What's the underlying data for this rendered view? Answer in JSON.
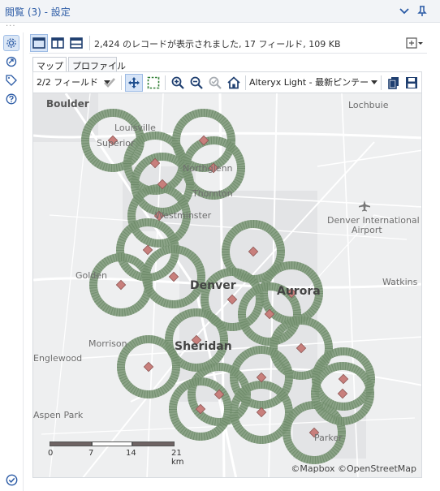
{
  "window": {
    "title": "閲覧 (3) - 設定",
    "icons": [
      "chevron-down-icon",
      "pin-icon"
    ]
  },
  "left_toolbar": {
    "items": [
      "settings-gear-icon",
      "connection-arrow-icon",
      "tag-icon",
      "help-icon"
    ],
    "bottom": "checkmark-circle-icon"
  },
  "view_bar": {
    "layout_buttons": [
      "single-pane-icon",
      "split-vertical-icon",
      "split-horizontal-icon"
    ],
    "record_info": "2,424 のレコードが表示されました, 17 フィールド, 109 KB",
    "add_button_icon": "add-window-icon"
  },
  "tabs": [
    {
      "label": "マップ",
      "active": true
    },
    {
      "label": "プロファイル",
      "active": false
    }
  ],
  "map_toolbar": {
    "fields_select": "2/2 フィールド",
    "basemap_select": "Alteryx Light - 最新ピンテー",
    "tool_icons": [
      "check-icon",
      "pan-move-icon",
      "rectangle-select-icon",
      "zoom-in-icon",
      "zoom-out-icon",
      "zoom-to-selection-icon",
      "home-icon",
      "copy-icon",
      "save-icon"
    ]
  },
  "map": {
    "place_labels": [
      "Boulder",
      "Lochbuie",
      "Louisville",
      "Superior",
      "Northglenn",
      "Thornton",
      "Westminster",
      "Denver International",
      "Airport",
      "Golden",
      "Denver",
      "Aurora",
      "Watkins",
      "Morrison",
      "Sheridan",
      "Englewood",
      "Aspen Park",
      "Parker"
    ],
    "attribution": "©Mapbox ©OpenStreetMap",
    "scale_labels": [
      "0",
      "7",
      "14",
      "21 km"
    ],
    "colors": {
      "background": "#eeeff0",
      "ring": "#7f9a7b",
      "marker": "#c87f7c",
      "road": "#ffffff"
    }
  }
}
